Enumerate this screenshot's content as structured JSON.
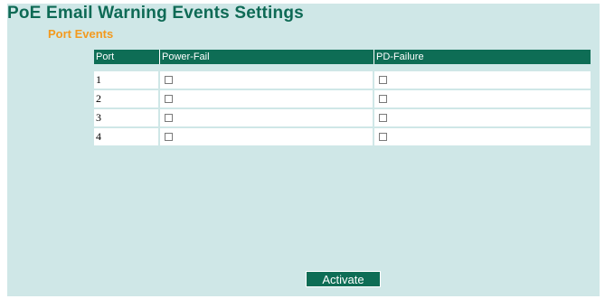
{
  "page": {
    "title": "PoE Email Warning Events Settings",
    "section_title": "Port Events"
  },
  "table": {
    "headers": [
      "Port",
      "Power-Fail",
      "PD-Failure"
    ],
    "rows": [
      {
        "port": "1",
        "power_fail": false,
        "pd_failure": false
      },
      {
        "port": "2",
        "power_fail": false,
        "pd_failure": false
      },
      {
        "port": "3",
        "power_fail": false,
        "pd_failure": false
      },
      {
        "port": "4",
        "power_fail": false,
        "pd_failure": false
      }
    ]
  },
  "actions": {
    "activate_label": "Activate"
  },
  "colors": {
    "background": "#cfe7e7",
    "header": "#0e6d55",
    "title": "#0e6a55",
    "section_title": "#f39a1e"
  }
}
